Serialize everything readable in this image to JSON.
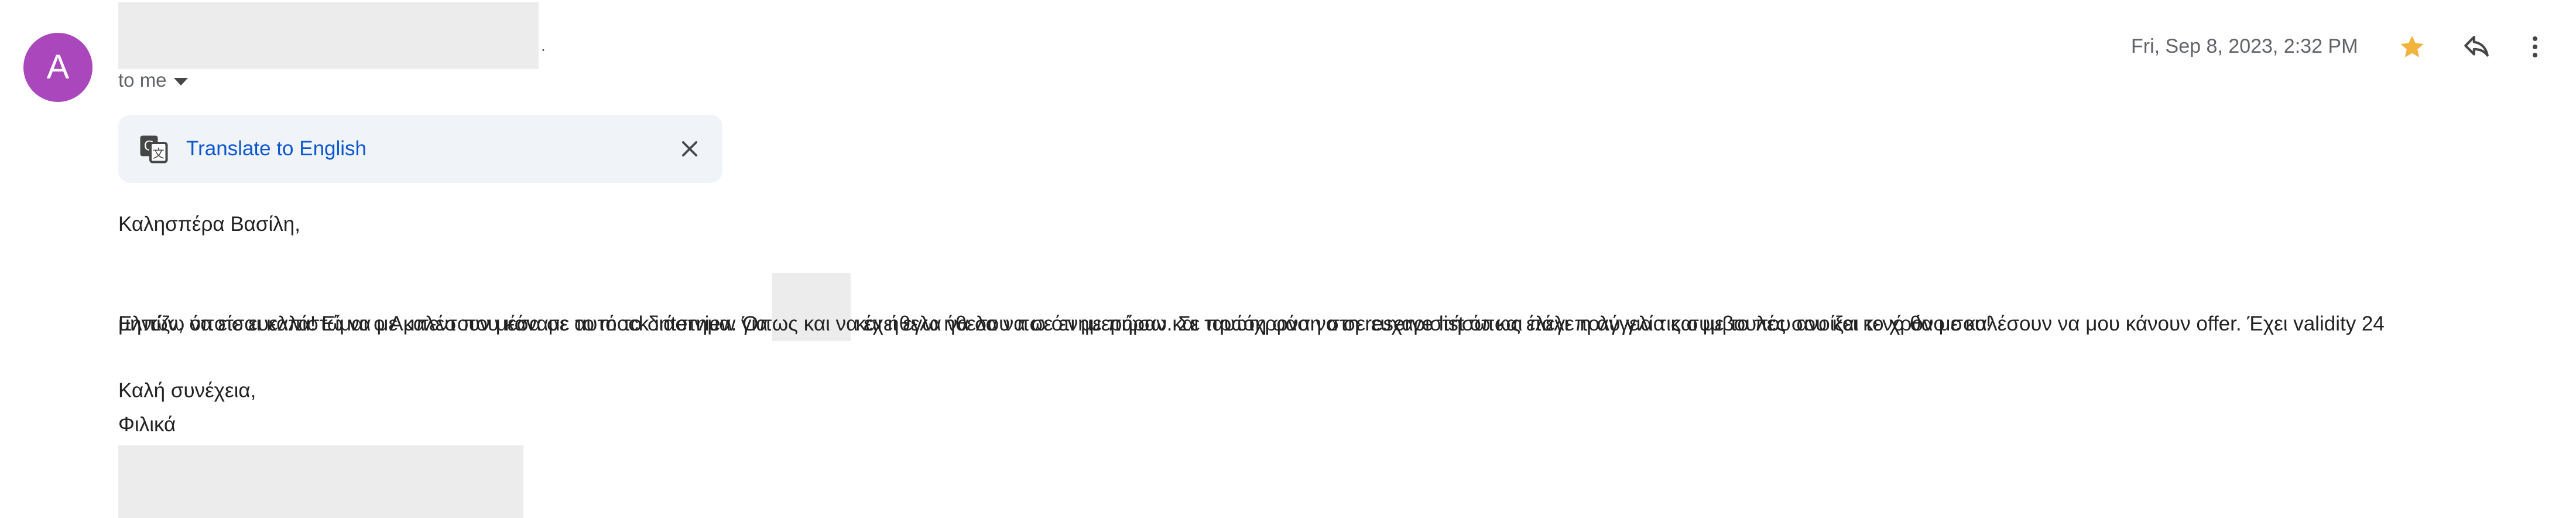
{
  "sender": {
    "avatar_initial": "A",
    "name": "",
    "redacted": true,
    "recipient_label": "to me"
  },
  "header": {
    "timestamp": "Fri, Sep 8, 2023, 2:32 PM",
    "star_icon": "star-icon",
    "reply_icon": "reply-icon",
    "more_icon": "more-vert-icon",
    "star_color": "#f2b33d"
  },
  "translate": {
    "link_label": "Translate to English",
    "icon": "translate-icon",
    "close_icon": "close-icon"
  },
  "message": {
    "greeting": "Καλησπέρα Βασίλη,",
    "para1_part1": "Ελπίζω να είσαι καλά! Είμαι ο Αμπεντ που κάναμε το mock interview για",
    "para1_part2": "και ήθελα να σου πω ότι με πήραν. Σε πρώτη φάση στη reserve list όπως έλεγε η αγγελία και με το που ανοίξει κενό θα με καλέσουν να μου κάνουν offer. Έχει validity 24",
    "para1_line2": "μηνών, όποτε ευελπιστώ να με καλέσουν μέσα σε αυτό το διάστημα. Όπως και να έχει εγω ήθελα να σε ενημερώσω και ταυτόχρονα να σε ευχαριστήσω και πάλι πολύ για τις συμβουλές σου και το χρόνο σου!",
    "closing1": "Καλή συνέχεια,",
    "closing2": "Φιλικά"
  },
  "colors": {
    "avatar_bg": "#ab47bc",
    "link": "#0b57d0",
    "translate_bar_bg": "#f0f4f9",
    "redaction": "#ececec"
  }
}
